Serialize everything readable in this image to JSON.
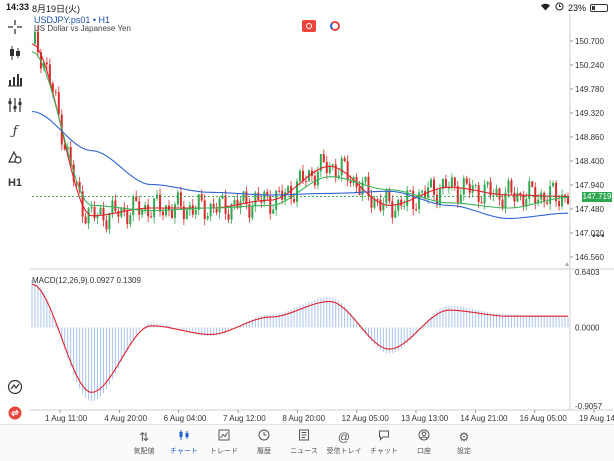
{
  "status": {
    "time": "14:33",
    "date": "8月19日(火)",
    "battery": "23%",
    "battery_level": 0.23
  },
  "left_toolbar": {
    "items": [
      {
        "icon": "crosshair-icon"
      },
      {
        "icon": "candlestick-icon"
      },
      {
        "icon": "bar-chart-icon"
      },
      {
        "icon": "indicator-icon"
      },
      {
        "icon": "function-icon"
      },
      {
        "icon": "drawing-objects-icon"
      },
      {
        "icon": "timeframe-icon",
        "label": "H1"
      },
      {
        "icon": "quick-indicator-icon"
      },
      {
        "icon": "trade-toggle-icon"
      }
    ]
  },
  "chart": {
    "symbol": "USDJPY.ps01 • H1",
    "description": "US Dollar vs Japanese Yen",
    "current_price": "147.719",
    "price_ticks": [
      "150.700",
      "150.240",
      "149.780",
      "149.320",
      "148.860",
      "148.400",
      "147.940",
      "147.480",
      "147.020",
      "146.560"
    ],
    "time_ticks": [
      "1 Aug 11:00",
      "4 Aug 20:00",
      "6 Aug 04:00",
      "7 Aug 12:00",
      "8 Aug 20:00",
      "12 Aug 05:00",
      "13 Aug 13:00",
      "14 Aug 21:00",
      "16 Aug 05:00",
      "19 Aug 14:00"
    ],
    "macd": {
      "label": "MACD(12,26,9) 0.0927 0.1309",
      "ticks": [
        "0.6403",
        "0.0000",
        "-0.9057"
      ]
    },
    "colors": {
      "up_candle": "#2fa84f",
      "down_candle": "#d92b2b",
      "ma_fast": "#e0222a",
      "ma_mid": "#3cb55a",
      "ma_slow": "#2f63d2",
      "macd_hist": "#a9c3ef",
      "macd_signal": "#e0222a"
    }
  },
  "chart_data": {
    "type": "line",
    "title": "USDJPY.ps01 • H1",
    "subtitle": "US Dollar vs Japanese Yen",
    "xlabel": "",
    "ylabel": "",
    "x": [
      "1 Aug 11:00",
      "4 Aug 20:00",
      "6 Aug 04:00",
      "7 Aug 12:00",
      "8 Aug 20:00",
      "12 Aug 05:00",
      "13 Aug 13:00",
      "14 Aug 21:00",
      "16 Aug 05:00",
      "19 Aug 14:00"
    ],
    "ylim": [
      146.35,
      150.95
    ],
    "series": [
      {
        "values": [
          150.65,
          147.35,
          147.5,
          147.5,
          147.65,
          148.3,
          147.55,
          147.9,
          147.75,
          147.72
        ]
      },
      {
        "values": [
          150.5,
          147.55,
          147.45,
          147.5,
          147.55,
          148.1,
          147.85,
          147.6,
          147.5,
          147.7
        ]
      },
      {
        "values": [
          149.35,
          148.6,
          147.95,
          147.8,
          147.75,
          147.78,
          147.82,
          147.55,
          147.3,
          147.4
        ]
      }
    ],
    "macd_ylim": [
      -0.9057,
      0.6403
    ],
    "macd_hist": [
      0.55,
      -0.85,
      0.05,
      -0.1,
      0.15,
      0.35,
      -0.3,
      0.25,
      0.15,
      0.12
    ],
    "macd_signal": [
      0.5,
      -0.75,
      0.02,
      -0.08,
      0.12,
      0.3,
      -0.25,
      0.2,
      0.13,
      0.13
    ],
    "grid": false,
    "legend": "none"
  },
  "bottom_nav": {
    "items": [
      {
        "label": "気配値",
        "icon": "quotes-icon"
      },
      {
        "label": "チャート",
        "icon": "chart-icon",
        "active": true
      },
      {
        "label": "トレード",
        "icon": "trade-icon"
      },
      {
        "label": "履歴",
        "icon": "history-icon"
      },
      {
        "label": "ニュース",
        "icon": "news-icon"
      },
      {
        "label": "受信トレイ",
        "icon": "mailbox-icon"
      },
      {
        "label": "チャット",
        "icon": "chat-icon"
      },
      {
        "label": "口座",
        "icon": "account-icon"
      },
      {
        "label": "設定",
        "icon": "settings-icon"
      }
    ]
  }
}
